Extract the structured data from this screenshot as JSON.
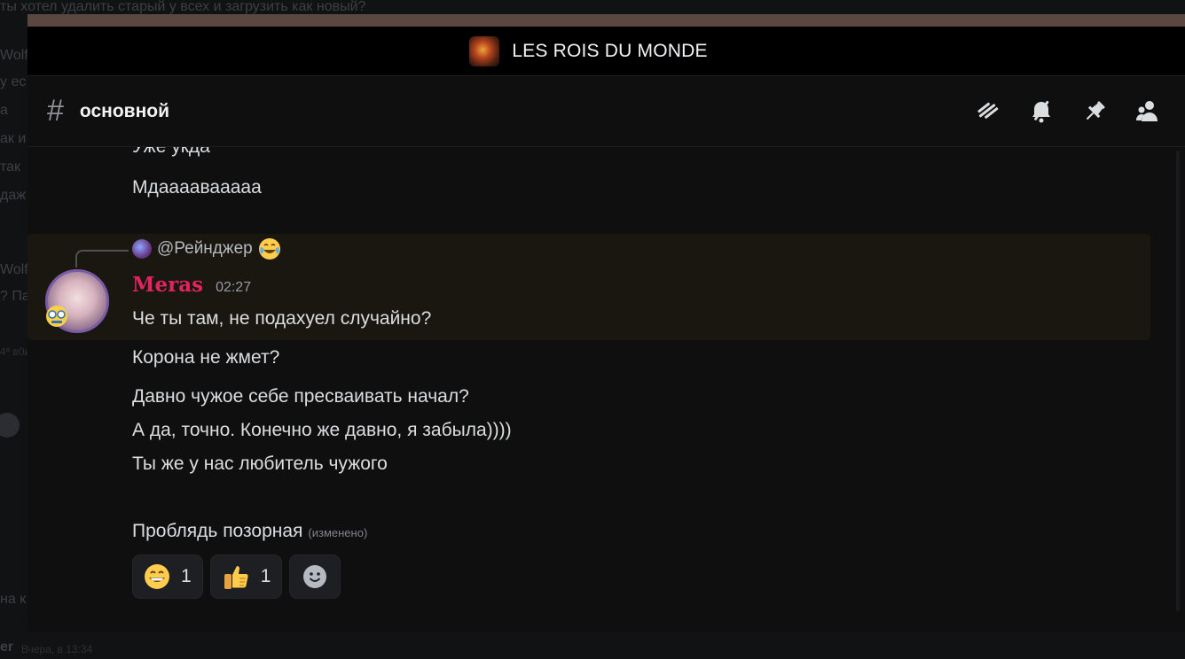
{
  "background": {
    "top_text": "ты хотел удалить старый у всех и загрузить как новый?",
    "left_fragments": [
      "Wolf",
      "у ес",
      "а",
      "ак и",
      "так",
      "даж",
      "Wolf",
      "? Па",
      "на к"
    ],
    "bottom_author": "er",
    "bottom_time": "Вчера, в 13:34",
    "small_fragment": "4ª в0и"
  },
  "window": {
    "guild_name": "LES ROIS DU MONDE",
    "channel_name": "основной",
    "toolbar": [
      {
        "icon": "threads-icon",
        "label": "Threads"
      },
      {
        "icon": "mute-bell-icon",
        "label": "Notification settings"
      },
      {
        "icon": "pin-icon",
        "label": "Pinned messages"
      },
      {
        "icon": "members-icon",
        "label": "Member list"
      }
    ]
  },
  "messages": {
    "prev_cut": "Уже укда",
    "prev_last": "Мдаааавааааа",
    "reply": {
      "name": "@Рейнджер",
      "emoji": "face-with-tears-of-joy"
    },
    "author": "Meras",
    "timestamp": "02:27",
    "lines": [
      "Че ты там, не подахуел случайно?",
      "Корона не жмет?",
      "Давно чужое себе пресваивать начал?",
      "А да, точно. Конечно же давно, я забыла))))",
      "Ты же у нас любитель чужого",
      "Проблядь позорная"
    ],
    "edited_label": "(изменено)",
    "reactions": [
      {
        "emoji": "grinning-face",
        "count": "1"
      },
      {
        "emoji": "thumbs-up",
        "count": "1"
      }
    ]
  },
  "colors": {
    "author": "#e0245e",
    "highlight": "#1a1710",
    "accent_bar": "#5b4640"
  }
}
